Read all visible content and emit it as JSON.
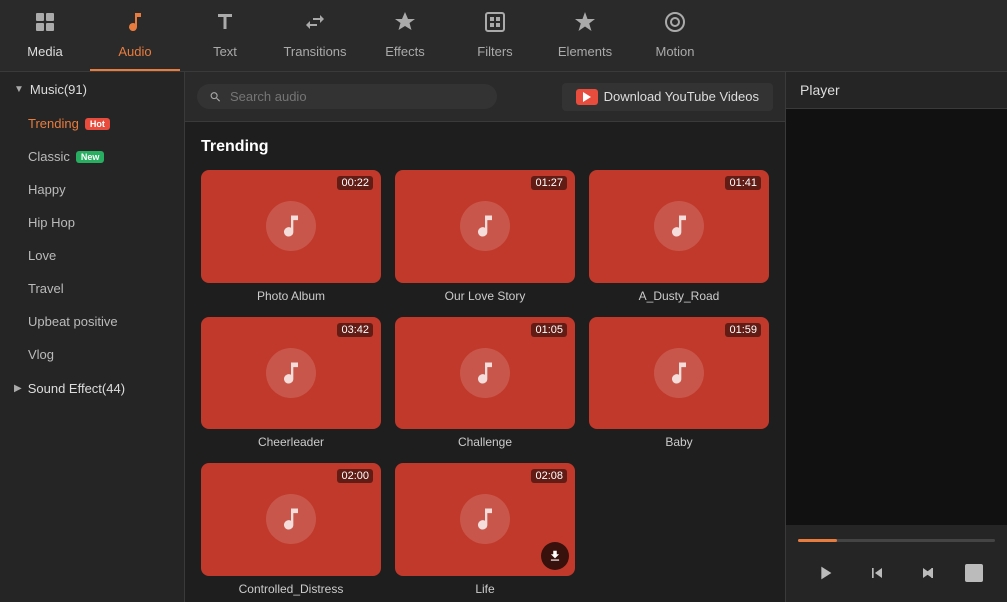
{
  "toolbar": {
    "items": [
      {
        "id": "media",
        "label": "Media",
        "icon": "📁",
        "active": false
      },
      {
        "id": "audio",
        "label": "Audio",
        "icon": "🎵",
        "active": true
      },
      {
        "id": "text",
        "label": "Text",
        "icon": "T",
        "active": false
      },
      {
        "id": "transitions",
        "label": "Transitions",
        "icon": "⇄",
        "active": false
      },
      {
        "id": "effects",
        "label": "Effects",
        "icon": "✦",
        "active": false
      },
      {
        "id": "filters",
        "label": "Filters",
        "icon": "⊞",
        "active": false
      },
      {
        "id": "elements",
        "label": "Elements",
        "icon": "❋",
        "active": false
      },
      {
        "id": "motion",
        "label": "Motion",
        "icon": "◎",
        "active": false
      }
    ]
  },
  "sidebar": {
    "sections": [
      {
        "id": "music",
        "label": "Music(91)",
        "expanded": true,
        "items": [
          {
            "id": "trending",
            "label": "Trending",
            "badge": "Hot",
            "badgeType": "hot",
            "active": true
          },
          {
            "id": "classic",
            "label": "Classic",
            "badge": "New",
            "badgeType": "new",
            "active": false
          },
          {
            "id": "happy",
            "label": "Happy",
            "badge": null,
            "active": false
          },
          {
            "id": "hiphop",
            "label": "Hip Hop",
            "badge": null,
            "active": false
          },
          {
            "id": "love",
            "label": "Love",
            "badge": null,
            "active": false
          },
          {
            "id": "travel",
            "label": "Travel",
            "badge": null,
            "active": false
          },
          {
            "id": "upbeat",
            "label": "Upbeat positive",
            "badge": null,
            "active": false
          },
          {
            "id": "vlog",
            "label": "Vlog",
            "badge": null,
            "active": false
          }
        ]
      },
      {
        "id": "soundeffect",
        "label": "Sound Effect(44)",
        "expanded": false,
        "items": []
      }
    ]
  },
  "search": {
    "placeholder": "Search audio",
    "value": ""
  },
  "youtube_button": {
    "label": "Download YouTube Videos"
  },
  "trending_section": {
    "title": "Trending",
    "cards": [
      {
        "id": 1,
        "title": "Photo Album",
        "duration": "00:22",
        "has_download": false
      },
      {
        "id": 2,
        "title": "Our Love Story",
        "duration": "01:27",
        "has_download": false
      },
      {
        "id": 3,
        "title": "A_Dusty_Road",
        "duration": "01:41",
        "has_download": false
      },
      {
        "id": 4,
        "title": "Cheerleader",
        "duration": "03:42",
        "has_download": false
      },
      {
        "id": 5,
        "title": "Challenge",
        "duration": "01:05",
        "has_download": false
      },
      {
        "id": 6,
        "title": "Baby",
        "duration": "01:59",
        "has_download": false
      },
      {
        "id": 7,
        "title": "Controlled_Distress",
        "duration": "02:00",
        "has_download": false
      },
      {
        "id": 8,
        "title": "Life",
        "duration": "02:08",
        "has_download": true
      }
    ]
  },
  "player": {
    "title": "Player",
    "progress_percent": 20
  },
  "colors": {
    "active_color": "#e87c3e",
    "card_bg": "#c0392b"
  }
}
